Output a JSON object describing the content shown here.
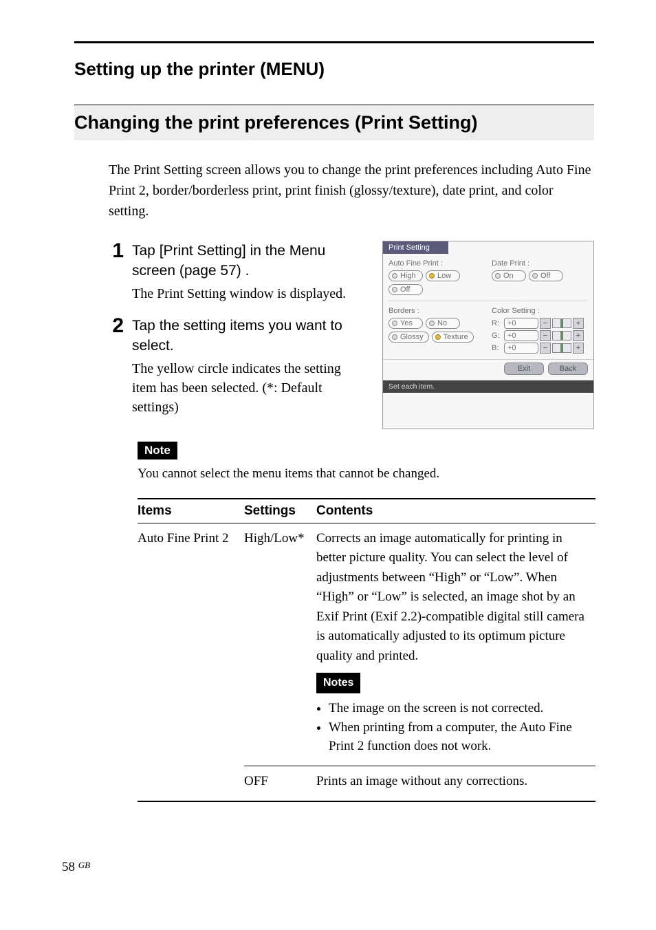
{
  "page": {
    "number": "58",
    "gb": "GB"
  },
  "superHeading": "Setting up the printer (MENU)",
  "sectionHeading": "Changing the print preferences (Print Setting)",
  "intro": "The Print Setting screen allows you to change the print preferences including Auto Fine Print 2, border/borderless print, print finish (glossy/texture), date print, and color setting.",
  "steps": [
    {
      "num": "1",
      "title": "Tap [Print Setting] in the Menu screen (page 57) .",
      "desc": "The Print Setting window is displayed."
    },
    {
      "num": "2",
      "title": "Tap the setting items you want to select.",
      "desc": "The yellow circle indicates the setting item has been selected. (*:  Default settings)"
    }
  ],
  "noteBadge": "Note",
  "noteText": "You cannot select the menu items that cannot be changed.",
  "table": {
    "headers": {
      "items": "Items",
      "settings": "Settings",
      "contents": "Contents"
    },
    "rows": [
      {
        "item": "Auto Fine Print 2",
        "setting": "High/Low*",
        "content": "Corrects an image automatically for printing in better picture quality. You can select the level of adjustments between “High” or “Low”.  When “High” or “Low” is selected, an image shot by an Exif Print (Exif 2.2)-compatible digital still camera is automatically adjusted to its optimum picture quality and printed.",
        "notesBadge": "Notes",
        "notes": [
          "The image on the screen is not corrected.",
          "When printing from a computer, the Auto Fine Print 2 function does not work."
        ]
      },
      {
        "item": "",
        "setting": "OFF",
        "content": "Prints an image without any corrections."
      }
    ]
  },
  "ui": {
    "title": "Print Setting",
    "afp": {
      "label": "Auto Fine Print :",
      "opts": [
        "High",
        "Low",
        "Off"
      ]
    },
    "date": {
      "label": "Date Print :",
      "opts": [
        "On",
        "Off"
      ]
    },
    "borders": {
      "label": "Borders :",
      "opts": [
        "Yes",
        "No",
        "Glossy",
        "Texture"
      ]
    },
    "color": {
      "label": "Color Setting :",
      "r": "R:",
      "g": "G:",
      "b": "B:",
      "val": "+0",
      "minus": "−",
      "plus": "+"
    },
    "exit": "Exit",
    "back": "Back",
    "status": "Set each item."
  }
}
